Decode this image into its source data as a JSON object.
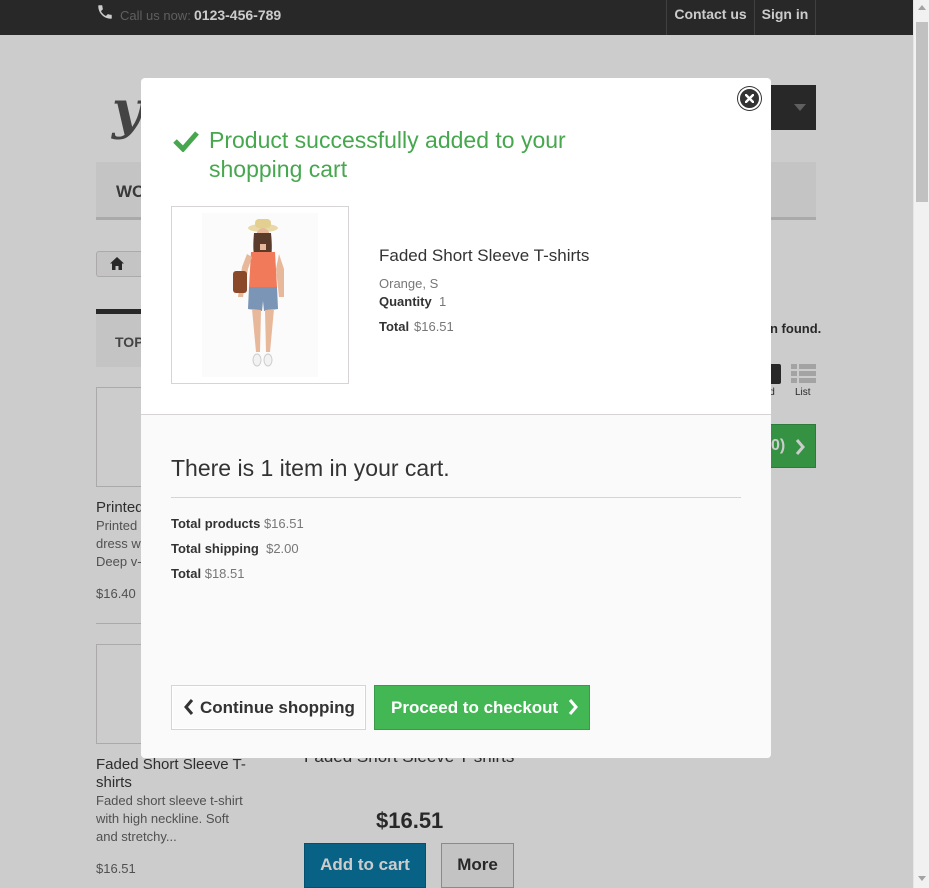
{
  "header": {
    "call_label": "Call us now:",
    "call_number": "0123-456-789",
    "contact_label": "Contact us",
    "signin_label": "Sign in"
  },
  "background": {
    "logo_text": "y",
    "menu_item": "WO",
    "left_block_title": "TOP",
    "products_found": "n found.",
    "view_grid_label": "id",
    "view_list_label": "List",
    "compare_label": "0)",
    "left_products": [
      {
        "title": "Printed",
        "desc": [
          "Printed",
          "dress w",
          "Deep v-"
        ],
        "price": "$16.40"
      },
      {
        "title": "Faded Short Sleeve T-shirts",
        "desc": [
          "Faded short sleeve t-shirt",
          "with high neckline. Soft",
          "and stretchy..."
        ],
        "price": "$16.51"
      }
    ],
    "main_product_title": "Faded Short Sleeve T-shirts",
    "main_price": "$16.51",
    "add_to_cart_label": "Add to cart",
    "more_label": "More"
  },
  "modal": {
    "success_message": "Product successfully added to your shopping cart",
    "product_name": "Faded Short Sleeve T-shirts",
    "product_attributes": "Orange, S",
    "quantity_label": "Quantity",
    "quantity_value": "1",
    "total_label": "Total",
    "total_value": "$16.51",
    "cart_count_text": "There is 1 item in your cart.",
    "total_products_label": "Total products",
    "total_products_value": "$16.51",
    "total_shipping_label": "Total shipping",
    "total_shipping_value": "$2.00",
    "grand_total_label": "Total",
    "grand_total_value": "$18.51",
    "continue_label": "Continue shopping",
    "checkout_label": "Proceed to checkout"
  },
  "colors": {
    "success_green": "#46a74e",
    "button_green": "#43b754",
    "button_blue": "#0b7ba8",
    "topbar": "#333333"
  }
}
